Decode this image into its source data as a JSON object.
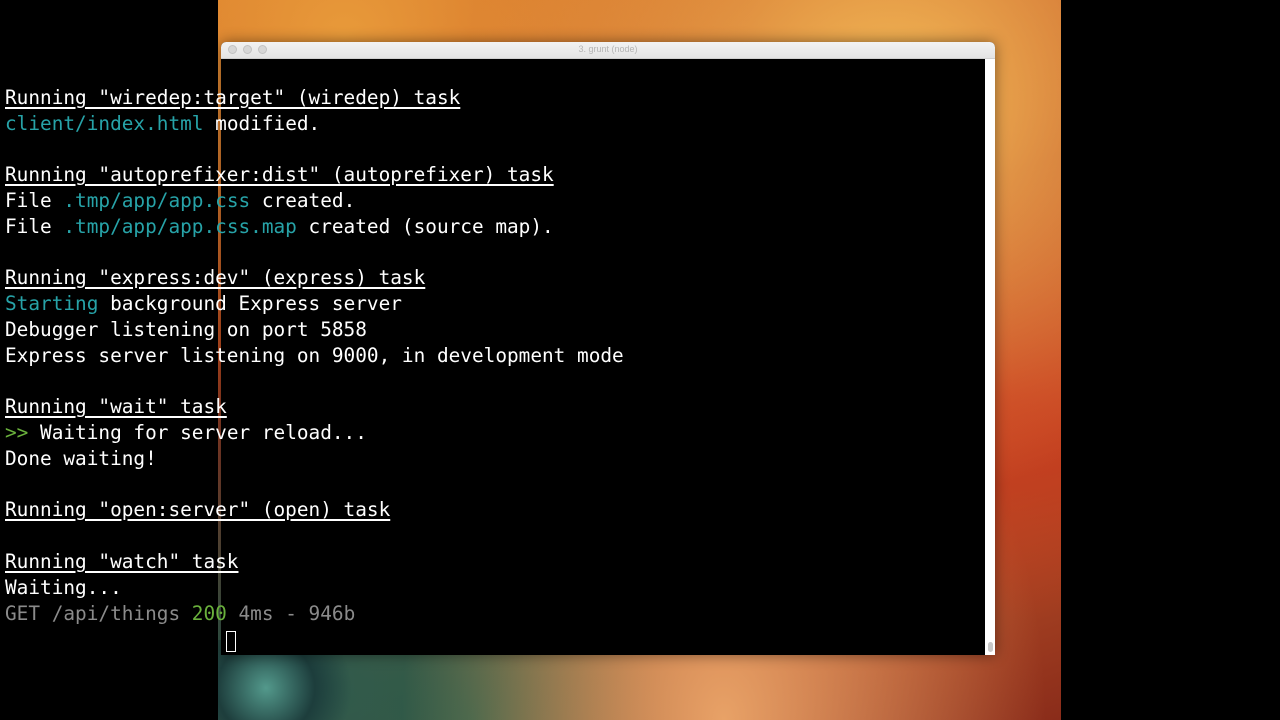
{
  "window": {
    "title": "3. grunt (node)"
  },
  "terminal": {
    "wiredep_header": "Running \"wiredep:target\" (wiredep) task",
    "wiredep_file": "client/index.html",
    "wiredep_status": " modified.",
    "autoprefixer_header": "Running \"autoprefixer:dist\" (autoprefixer) task",
    "file1_prefix": "File ",
    "file1_path": ".tmp/app/app.css",
    "file1_suffix": " created.",
    "file2_prefix": "File ",
    "file2_path": ".tmp/app/app.css.map",
    "file2_suffix": " created (source map).",
    "express_header": "Running \"express:dev\" (express) task",
    "starting_word": "Starting",
    "starting_rest": " background Express server",
    "debugger_line": "Debugger listening on port 5858",
    "express_line": "Express server listening on 9000, in development mode",
    "wait_header": "Running \"wait\" task",
    "wait_prompt": ">>",
    "wait_text": " Waiting for server reload...",
    "done_waiting": "Done waiting!",
    "open_header": "Running \"open:server\" (open) task",
    "watch_header": "Running \"watch\" task",
    "watch_waiting": "Waiting...",
    "get_request": "GET /api/things ",
    "get_status": "200",
    "get_timing": " 4ms - 946b"
  },
  "colors": {
    "terminal_background": "#000000",
    "text": "#ffffff",
    "path_cyan": "#27a3a8",
    "status_green": "#6ab13c",
    "dim_gray": "#8b8b8b"
  }
}
